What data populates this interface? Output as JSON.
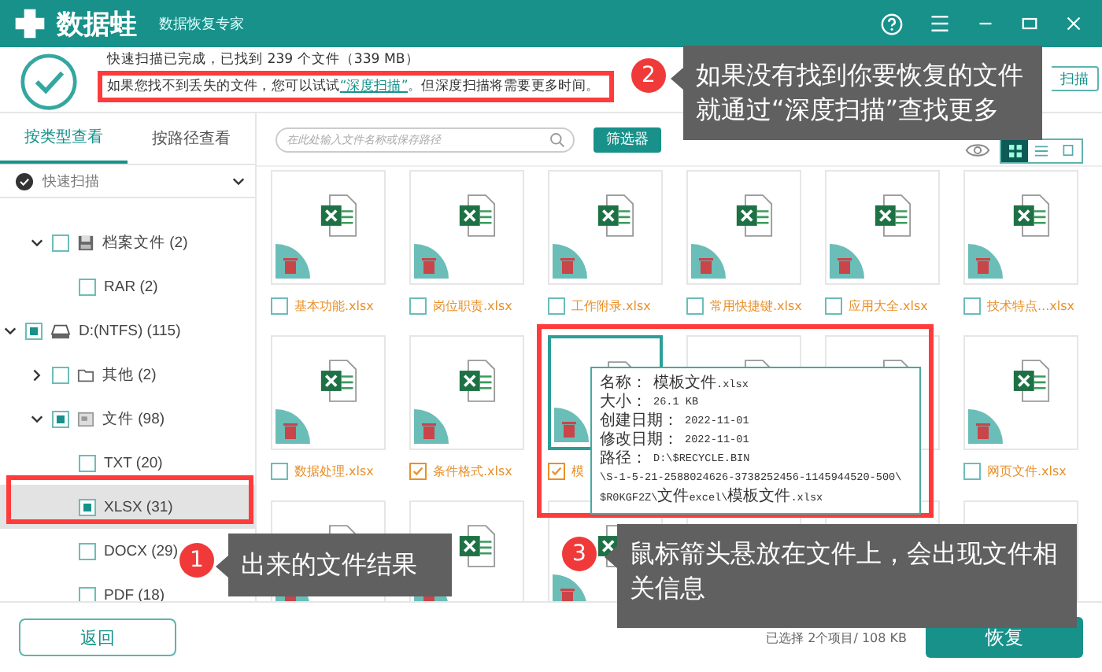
{
  "app": {
    "name": "数据蛙",
    "subtitle": "数据恢复专家"
  },
  "scan": {
    "status": "快速扫描已完成，已找到 239 个文件（339 MB）",
    "hint_before": "如果您找不到丢失的文件，您可以试试",
    "hint_link": "“深度扫描”",
    "hint_after": "。但深度扫描将需要更多时间。",
    "deep_scan_button": "扫描"
  },
  "tabs": [
    {
      "label": "按类型查看",
      "selected": true
    },
    {
      "label": "按路径查看",
      "selected": false
    }
  ],
  "scan_select": "快速扫描",
  "tree": [
    {
      "kind": "archive",
      "label": "档案文件 (2)",
      "expanded": true,
      "partial": false,
      "selected": false,
      "children": [
        {
          "label": "RAR (2)",
          "partial": false,
          "selected": false
        }
      ]
    },
    {
      "kind": "drive",
      "label": "D:(NTFS) (115)",
      "expanded": true,
      "partial": true,
      "selected": false,
      "children": [
        {
          "kind": "folder",
          "label": "其他 (2)",
          "expanded": false,
          "partial": false,
          "selected": false
        },
        {
          "kind": "document",
          "label": "文件 (98)",
          "expanded": true,
          "partial": true,
          "selected": false,
          "children": [
            {
              "label": "TXT (20)",
              "partial": false,
              "selected": false
            },
            {
              "label": "XLSX (31)",
              "partial": true,
              "selected": true
            },
            {
              "label": "DOCX (29)",
              "partial": false,
              "selected": false
            },
            {
              "label": "PDF (18)",
              "partial": false,
              "selected": false
            }
          ]
        }
      ]
    }
  ],
  "search": {
    "placeholder": "在此处输入文件名称或保存路径"
  },
  "filter_button": "筛选器",
  "view_modes": [
    {
      "kind": "grid",
      "selected": true
    },
    {
      "kind": "list",
      "selected": false
    },
    {
      "kind": "detail",
      "selected": false
    }
  ],
  "files": [
    {
      "kind": "xlsx",
      "name": "基本功能.xlsx",
      "checked": false,
      "selected": false
    },
    {
      "kind": "xlsx",
      "name": "岗位职责.xlsx",
      "checked": false,
      "selected": false
    },
    {
      "kind": "xlsx",
      "name": "工作附录.xlsx",
      "checked": false,
      "selected": false
    },
    {
      "kind": "xlsx",
      "name": "常用快捷键.xlsx",
      "checked": false,
      "selected": false
    },
    {
      "kind": "xlsx",
      "name": "应用大全.xlsx",
      "checked": false,
      "selected": false
    },
    {
      "kind": "xlsx",
      "name": "技术特点...xlsx",
      "checked": false,
      "selected": false
    },
    {
      "kind": "xlsx",
      "name": "数据处理.xlsx",
      "checked": false,
      "selected": false
    },
    {
      "kind": "xlsx",
      "name": "条件格式.xlsx",
      "checked": true,
      "selected": false
    },
    {
      "kind": "xlsx",
      "name": "模",
      "checked": true,
      "selected": true
    },
    {
      "kind": "xlsx",
      "selected": false
    },
    {
      "kind": "xlsx",
      "selected": false
    },
    {
      "kind": "xlsx",
      "name": "网页文件.xlsx",
      "checked": false,
      "selected": false
    },
    {
      "kind": "xlsx",
      "selected": false
    },
    {
      "kind": "xlsx",
      "selected": false
    },
    {
      "kind": "xlsx",
      "selected": false
    },
    {
      "kind": "xlsx",
      "selected": false
    },
    {
      "kind": "xlsx",
      "selected": false
    },
    {
      "kind": "xlsx",
      "selected": false
    }
  ],
  "tooltip": {
    "rows": [
      {
        "label": "名称：",
        "value": "模板文件.xlsx"
      },
      {
        "label": "大小：",
        "value": "26.1 KB"
      },
      {
        "label": "创建日期：",
        "value": "2022-11-01"
      },
      {
        "label": "修改日期：",
        "value": "2022-11-01"
      },
      {
        "label": "路径：",
        "value": "D:\\$RECYCLE.BIN"
      }
    ],
    "path_continuation": [
      "\\S-1-5-21-2588024626-3738252456-1145944520-500\\",
      "$R0KGF2Z\\文件excel\\模板文件.xlsx"
    ]
  },
  "callouts": [
    {
      "number": "2",
      "text": "如果没有找到你要恢复的文件就通过“深度扫描”查找更多"
    },
    {
      "number": "1",
      "text": "出来的文件结果"
    },
    {
      "number": "3",
      "text": "鼠标箭头悬放在文件上，会出现文件相关信息"
    }
  ],
  "footer": {
    "back_button": "返回",
    "selection": "已选择 2个项目/ 108 KB",
    "recover_button": "恢复"
  }
}
